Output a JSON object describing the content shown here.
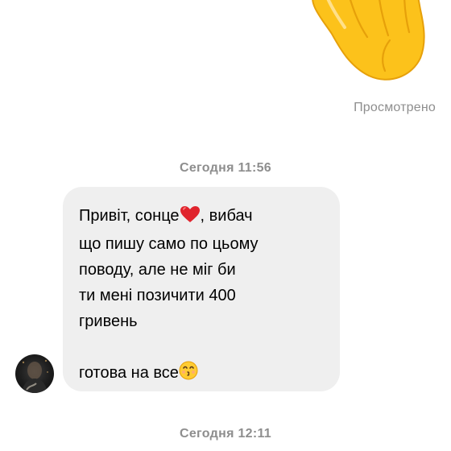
{
  "header": {
    "reaction_icon": "waving-hand-emoji",
    "seen_label": "Просмотрено"
  },
  "timestamps": [
    "Сегодня 11:56",
    "Сегодня 12:11"
  ],
  "message": {
    "lines": [
      "Привіт, сонце",
      ", вибач",
      "що пишу само по цьому",
      "поводу, але не міг би",
      "ти мені позичити 400",
      "гривень",
      "готова на все"
    ],
    "emoji_heart": "red-heart-emoji",
    "emoji_kiss": "kissing-face-emoji"
  },
  "colors": {
    "bubble_bg": "#efefef",
    "meta_text": "#8e8e8e"
  }
}
